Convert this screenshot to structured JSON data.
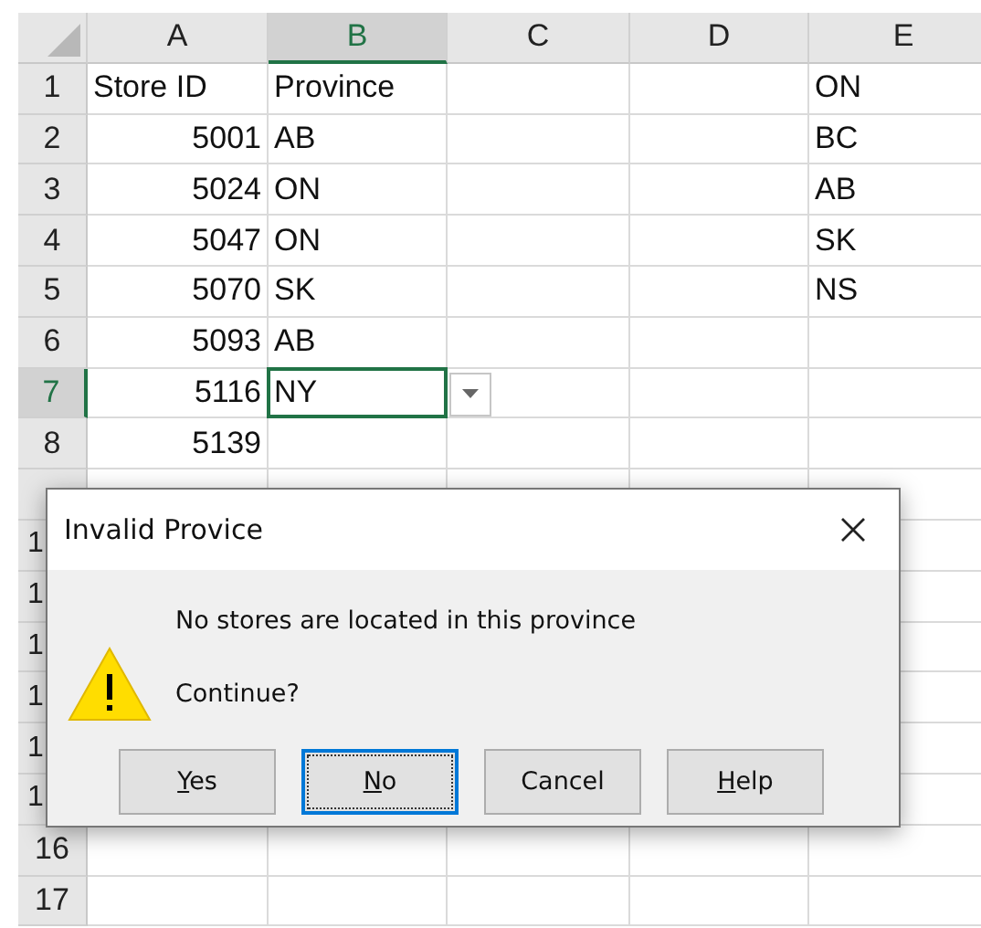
{
  "sheet": {
    "columns": [
      {
        "label": "A",
        "selected": false
      },
      {
        "label": "B",
        "selected": true
      },
      {
        "label": "C",
        "selected": false
      },
      {
        "label": "D",
        "selected": false
      },
      {
        "label": "E",
        "selected": false
      }
    ],
    "rows": [
      {
        "label": "1",
        "selected": false,
        "label_clipped": false,
        "cells": [
          {
            "kind": "text",
            "text": "Store ID",
            "active": false
          },
          {
            "kind": "text",
            "text": "Province",
            "active": false
          },
          {
            "kind": "empty",
            "active": false
          },
          {
            "kind": "empty",
            "active": false
          },
          {
            "kind": "text",
            "text": "ON",
            "active": false
          }
        ]
      },
      {
        "label": "2",
        "selected": false,
        "label_clipped": false,
        "cells": [
          {
            "kind": "number",
            "text": "5001",
            "active": false
          },
          {
            "kind": "text",
            "text": "AB",
            "active": false
          },
          {
            "kind": "empty",
            "active": false
          },
          {
            "kind": "empty",
            "active": false
          },
          {
            "kind": "text",
            "text": "BC",
            "active": false
          }
        ]
      },
      {
        "label": "3",
        "selected": false,
        "label_clipped": false,
        "cells": [
          {
            "kind": "number",
            "text": "5024",
            "active": false
          },
          {
            "kind": "text",
            "text": "ON",
            "active": false
          },
          {
            "kind": "empty",
            "active": false
          },
          {
            "kind": "empty",
            "active": false
          },
          {
            "kind": "text",
            "text": "AB",
            "active": false
          }
        ]
      },
      {
        "label": "4",
        "selected": false,
        "label_clipped": false,
        "cells": [
          {
            "kind": "number",
            "text": "5047",
            "active": false
          },
          {
            "kind": "text",
            "text": "ON",
            "active": false
          },
          {
            "kind": "empty",
            "active": false
          },
          {
            "kind": "empty",
            "active": false
          },
          {
            "kind": "text",
            "text": "SK",
            "active": false
          }
        ]
      },
      {
        "label": "5",
        "selected": false,
        "label_clipped": false,
        "cells": [
          {
            "kind": "number",
            "text": "5070",
            "active": false
          },
          {
            "kind": "text",
            "text": "SK",
            "active": false
          },
          {
            "kind": "empty",
            "active": false
          },
          {
            "kind": "empty",
            "active": false
          },
          {
            "kind": "text",
            "text": "NS",
            "active": false
          }
        ]
      },
      {
        "label": "6",
        "selected": false,
        "label_clipped": false,
        "cells": [
          {
            "kind": "number",
            "text": "5093",
            "active": false
          },
          {
            "kind": "text",
            "text": "AB",
            "active": false
          }
        ]
      },
      {
        "label": "7",
        "selected": true,
        "label_clipped": false,
        "cells": [
          {
            "kind": "number",
            "text": "5116",
            "active": false
          },
          {
            "kind": "text",
            "text": "NY",
            "active": true,
            "dropdown": true
          }
        ]
      },
      {
        "label": "8",
        "selected": false,
        "label_clipped": false,
        "cells": [
          {
            "kind": "number",
            "text": "5139",
            "active": false
          }
        ]
      },
      {
        "selected": false
      },
      {
        "label": "1",
        "selected": false,
        "label_clipped": true
      },
      {
        "label": "1",
        "selected": false,
        "label_clipped": true
      },
      {
        "label": "1",
        "selected": false,
        "label_clipped": true
      },
      {
        "label": "1",
        "selected": false,
        "label_clipped": true
      },
      {
        "label": "1",
        "selected": false,
        "label_clipped": true
      },
      {
        "label": "1",
        "selected": false,
        "label_clipped": true
      },
      {
        "label": "16",
        "selected": false,
        "label_clipped": false
      },
      {
        "label": "17",
        "selected": false,
        "label_clipped": false
      }
    ]
  },
  "dialog": {
    "title": "Invalid Provice",
    "message": "No stores are located in this province",
    "question": "Continue?",
    "buttons": [
      {
        "label": "Yes",
        "underline_first": true,
        "focused": false
      },
      {
        "label": "No",
        "underline_first": true,
        "focused": true
      },
      {
        "label": "Cancel",
        "underline_first": false,
        "focused": false
      },
      {
        "label": "Help",
        "underline_first": true,
        "focused": false
      }
    ]
  }
}
